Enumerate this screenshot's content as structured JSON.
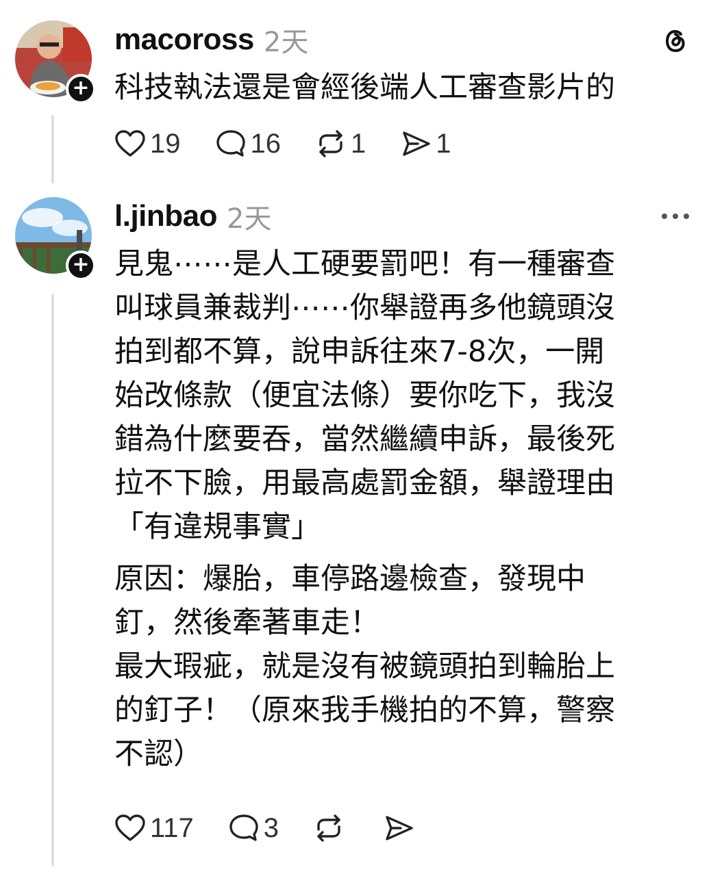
{
  "posts": [
    {
      "username": "macoross",
      "time": "2天",
      "paragraphs": [
        "科技執法還是會經後端人工審查影片的"
      ],
      "likes": "19",
      "replies": "16",
      "reposts": "1",
      "shares": "1",
      "header_icon": "threads-logo-icon"
    },
    {
      "username": "l.jinbao",
      "time": "2天",
      "paragraphs": [
        "見鬼⋯⋯是人工硬要罰吧！有一種審查\n叫球員兼裁判⋯⋯你舉證再多他鏡頭沒\n拍到都不算，說申訴往來7-8次，一開\n始改條款（便宜法條）要你吃下，我沒\n錯為什麼要吞，當然繼續申訴，最後死\n拉不下臉，用最高處罰金額，舉證理由\n「有違規事實」",
        "原因：爆胎，車停路邊檢查，發現中\n釘，然後牽著車走！",
        "最大瑕疵，就是沒有被鏡頭拍到輪胎上\n的釘子！（原來我手機拍的不算，警察\n不認）"
      ],
      "likes": "117",
      "replies": "3",
      "reposts": "",
      "shares": "",
      "header_icon": "more-options-icon"
    }
  ],
  "colors": {
    "text": "#111111",
    "muted": "#999999",
    "thread_line": "#dedede"
  }
}
